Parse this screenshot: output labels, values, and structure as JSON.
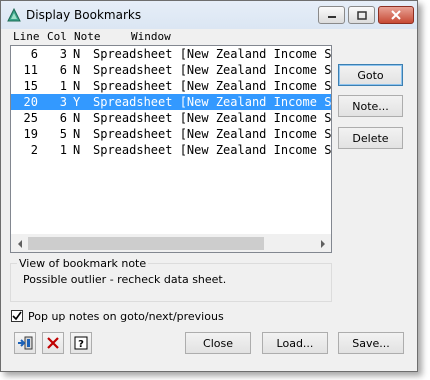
{
  "window": {
    "title": "Display Bookmarks"
  },
  "list": {
    "headers": {
      "line": "Line",
      "col": "Col",
      "note": "Note",
      "window": "Window"
    },
    "rows": [
      {
        "line": "6",
        "col": "3",
        "note": "N",
        "window": "Spreadsheet [New Zealand Income Su"
      },
      {
        "line": "11",
        "col": "6",
        "note": "N",
        "window": "Spreadsheet [New Zealand Income Su"
      },
      {
        "line": "15",
        "col": "1",
        "note": "N",
        "window": "Spreadsheet [New Zealand Income Su"
      },
      {
        "line": "20",
        "col": "3",
        "note": "Y",
        "window": "Spreadsheet [New Zealand Income Su"
      },
      {
        "line": "25",
        "col": "6",
        "note": "N",
        "window": "Spreadsheet [New Zealand Income Su"
      },
      {
        "line": "19",
        "col": "5",
        "note": "N",
        "window": "Spreadsheet [New Zealand Income Su"
      },
      {
        "line": "2",
        "col": "1",
        "note": "N",
        "window": "Spreadsheet [New Zealand Income Su"
      }
    ],
    "selected_index": 3
  },
  "side_buttons": {
    "goto": "Goto",
    "note": "Note...",
    "delete": "Delete"
  },
  "note_group": {
    "legend": "View of bookmark note",
    "text": "Possible outlier - recheck data sheet."
  },
  "checkbox": {
    "label": "Pop up notes on goto/next/previous",
    "checked": true
  },
  "bottom_buttons": {
    "close": "Close",
    "load": "Load...",
    "save": "Save..."
  },
  "colors": {
    "selection": "#3399ff",
    "accent_border": "#3c7fb1",
    "close_red": "#c74a35"
  }
}
